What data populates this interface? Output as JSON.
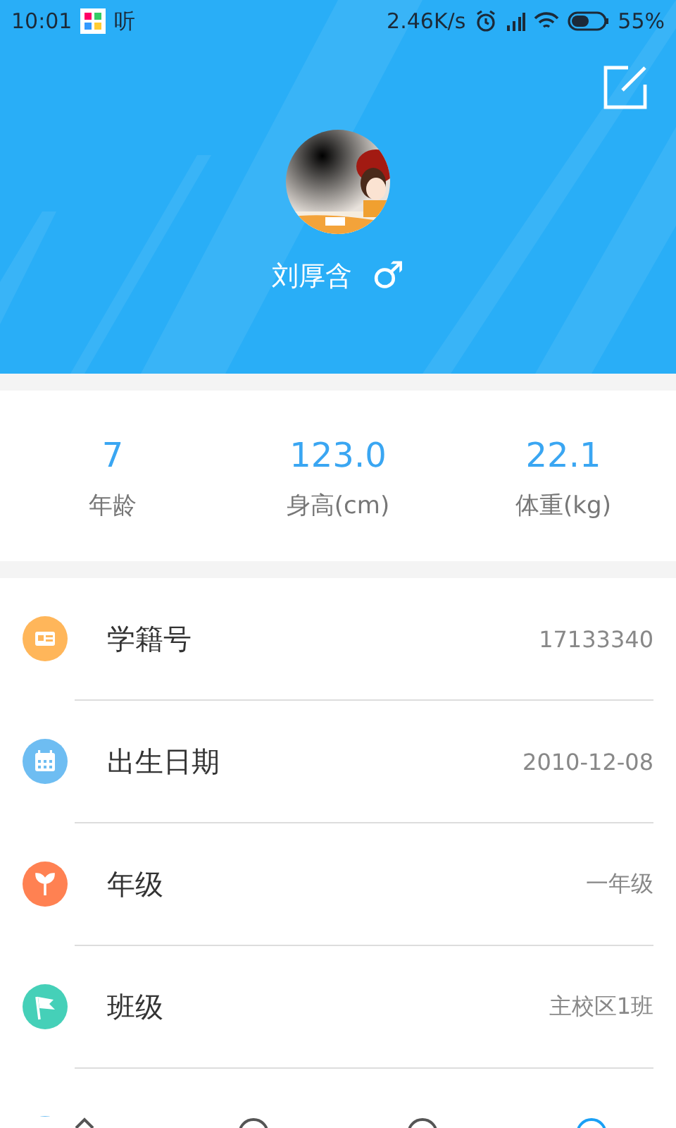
{
  "status_bar": {
    "time": "10:01",
    "notification": "听",
    "speed": "2.46K/s",
    "battery": "55%"
  },
  "profile": {
    "name": "刘厚含",
    "gender_symbol": "♂"
  },
  "stats": [
    {
      "value": "7",
      "label": "年龄"
    },
    {
      "value": "123.0",
      "label": "身高(cm)"
    },
    {
      "value": "22.1",
      "label": "体重(kg)"
    }
  ],
  "info_rows": [
    {
      "kind": "id-card",
      "color": "#ffb65a",
      "label": "学籍号",
      "value": "17133340"
    },
    {
      "kind": "calendar",
      "color": "#6ebdf2",
      "label": "出生日期",
      "value": "2010-12-08"
    },
    {
      "kind": "sprout",
      "color": "#ff8152",
      "label": "年级",
      "value": "一年级"
    },
    {
      "kind": "flag",
      "color": "#45d0b8",
      "label": "班级",
      "value": "主校区1班"
    }
  ],
  "tab_bar": [
    {
      "selected": false
    },
    {
      "selected": false
    },
    {
      "selected": false
    },
    {
      "selected": true
    }
  ]
}
